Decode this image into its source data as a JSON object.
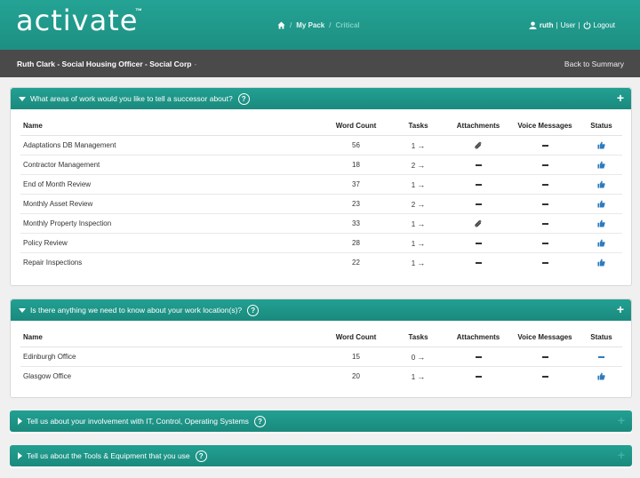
{
  "app": {
    "logo": "activate",
    "logo_tm": "™"
  },
  "breadcrumbs": [
    {
      "label": "My Pack"
    },
    {
      "label": "Critical"
    }
  ],
  "user": {
    "name": "ruth",
    "role": "User",
    "logout": "Logout"
  },
  "subbar": {
    "who": "Ruth Clark - Social Housing Officer - Social Corp",
    "back": "Back to Summary"
  },
  "columns": {
    "name": "Name",
    "word_count": "Word Count",
    "tasks": "Tasks",
    "attachments": "Attachments",
    "voice": "Voice Messages",
    "status": "Status"
  },
  "sections": [
    {
      "title": "What areas of work would you like to tell a successor about?",
      "rows": [
        {
          "name": "Adaptations DB Management",
          "words": "56",
          "tasks": "1",
          "attach": "clip",
          "voice": "dash",
          "status": "thumb"
        },
        {
          "name": "Contractor Management",
          "words": "18",
          "tasks": "2",
          "attach": "dash",
          "voice": "dash",
          "status": "thumb"
        },
        {
          "name": "End of Month Review",
          "words": "37",
          "tasks": "1",
          "attach": "dash",
          "voice": "dash",
          "status": "thumb"
        },
        {
          "name": "Monthly Asset Review",
          "words": "23",
          "tasks": "2",
          "attach": "dash",
          "voice": "dash",
          "status": "thumb"
        },
        {
          "name": "Monthly Property Inspection",
          "words": "33",
          "tasks": "1",
          "attach": "clip",
          "voice": "dash",
          "status": "thumb"
        },
        {
          "name": "Policy Review",
          "words": "28",
          "tasks": "1",
          "attach": "dash",
          "voice": "dash",
          "status": "thumb"
        },
        {
          "name": "Repair Inspections",
          "words": "22",
          "tasks": "1",
          "attach": "dash",
          "voice": "dash",
          "status": "thumb"
        }
      ]
    },
    {
      "title": "Is there anything we need to know about your work location(s)?",
      "rows": [
        {
          "name": "Edinburgh Office",
          "words": "15",
          "tasks": "0",
          "attach": "dash",
          "voice": "dash",
          "status": "dash"
        },
        {
          "name": "Glasgow Office",
          "words": "20",
          "tasks": "1",
          "attach": "dash",
          "voice": "dash",
          "status": "thumb"
        }
      ]
    },
    {
      "title": "Tell us about your involvement with IT, Control, Operating Systems"
    },
    {
      "title": "Tell us about the Tools & Equipment that you use"
    }
  ],
  "colors": {
    "teal": "#1c8f82",
    "dark_bar": "#4a4a4a",
    "status_blue": "#2d7bbf"
  }
}
